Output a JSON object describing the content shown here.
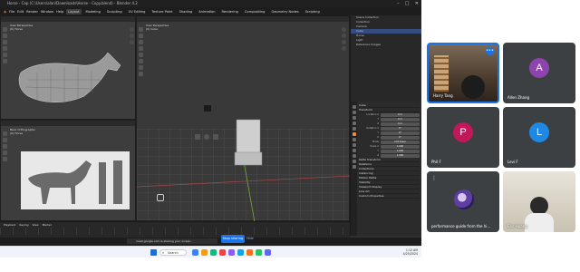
{
  "blender": {
    "title": "Horse - Cap (C:\\Users\\alan\\Downloads\\Horse - Copy.blend) - Blender 4.2",
    "menu": [
      "File",
      "Edit",
      "Render",
      "Window",
      "Help"
    ],
    "workspaces": [
      "Layout",
      "Modeling",
      "Sculpting",
      "UV Editing",
      "Texture Paint",
      "Shading",
      "Animation",
      "Rendering",
      "Compositing",
      "Geometry Nodes",
      "Scripting"
    ],
    "viewports": {
      "top_left": {
        "line1": "User Perspective",
        "line2": "(0) Horse"
      },
      "bottom_left": {
        "line1": "Back Orthographic",
        "line2": "(0) Horse"
      },
      "main": {
        "line1": "User Perspective",
        "line2": "(0) Cube"
      }
    },
    "outliner": [
      "Scene Collection",
      "Collection",
      "Camera",
      "Cube",
      "Horse",
      "Light",
      "Reference Images"
    ],
    "properties": {
      "object_name": "Cube",
      "sections": [
        "Transform",
        "Delta Transform",
        "Relations",
        "Collections",
        "Instancing",
        "Motion Paths",
        "Visibility",
        "Viewport Display",
        "Line Art",
        "Custom Properties"
      ],
      "fields": [
        {
          "k": "Location X",
          "v": "0 m"
        },
        {
          "k": "Y",
          "v": "0 m"
        },
        {
          "k": "Z",
          "v": "0 m"
        },
        {
          "k": "Rotation X",
          "v": "0°"
        },
        {
          "k": "Y",
          "v": "0°"
        },
        {
          "k": "Z",
          "v": "0°"
        },
        {
          "k": "Mode",
          "v": "XYZ Euler"
        },
        {
          "k": "Scale X",
          "v": "1.000"
        },
        {
          "k": "Y",
          "v": "1.000"
        },
        {
          "k": "Z",
          "v": "1.000"
        }
      ]
    },
    "timeline": {
      "menu": [
        "Playback",
        "Keying",
        "View",
        "Marker"
      ]
    },
    "toast": "meet.google.com is sharing your screen.",
    "stop_sharing": "Stop sharing",
    "hide": "Hide"
  },
  "taskbar": {
    "search_placeholder": "Search",
    "time": "1:12 AM",
    "date": "4/25/2024",
    "colors": [
      "#3b82f6",
      "#f59e0b",
      "#10b981",
      "#ef4444",
      "#8b5cf6",
      "#0ea5e9",
      "#f97316",
      "#22c55e",
      "#6366f1"
    ]
  },
  "meeting": {
    "tiles": [
      {
        "name": "Harry Tang",
        "kind": "video",
        "speaking": true
      },
      {
        "name": "Allen Zhang",
        "kind": "avatar",
        "initial": "A",
        "color": "#8e44ad"
      },
      {
        "name": "Phil F",
        "kind": "avatar",
        "initial": "P",
        "color": "#c2185b"
      },
      {
        "name": "Levi F",
        "kind": "avatar",
        "initial": "L",
        "color": "#1e88e5"
      },
      {
        "name": "performance guide from the hi...",
        "kind": "image"
      },
      {
        "name": "Eric Huang",
        "kind": "video"
      }
    ]
  }
}
